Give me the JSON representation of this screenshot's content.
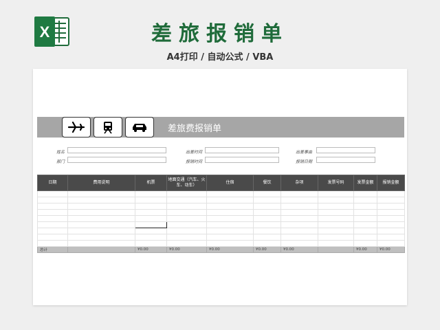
{
  "header": {
    "title": "差旅报销单",
    "subtitle": "A4打印 / 自动公式 / VBA"
  },
  "sheet": {
    "banner_title": "差旅费报销单",
    "icons": [
      "airplane-icon",
      "train-icon",
      "car-icon"
    ],
    "form": {
      "name_label": "姓名",
      "dept_label": "部门",
      "depart_time_label": "出差时间",
      "reimburse_time_label": "报销时间",
      "reason_label": "出差事由",
      "reimburse_date_label": "报销日期"
    },
    "columns": [
      "日期",
      "费用说明",
      "机票",
      "地面交通（汽车、火车、动车）",
      "住宿",
      "餐饮",
      "杂项",
      "发票号码",
      "发票金额",
      "报销金额"
    ],
    "empty_rows": 9,
    "total_row": [
      "总计",
      "",
      "¥0.00",
      "¥0.00",
      "¥0.00",
      "¥0.00",
      "¥0.00",
      "",
      "¥0.00",
      "¥0.00"
    ]
  }
}
